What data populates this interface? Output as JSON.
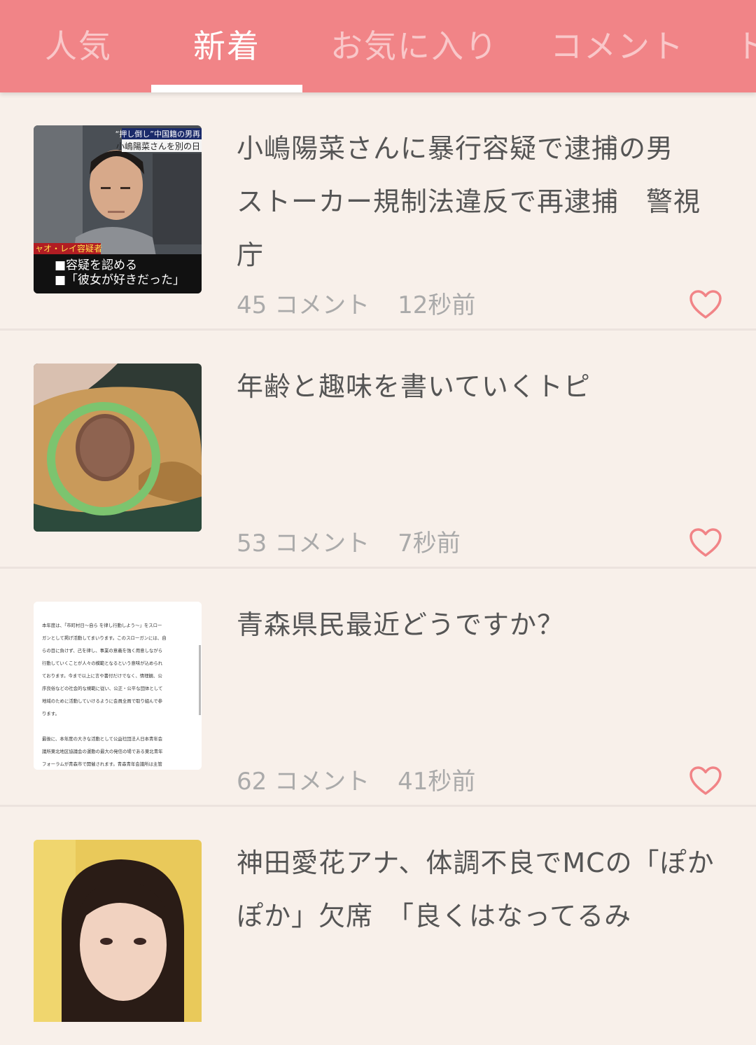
{
  "tabs": [
    {
      "label": "人気",
      "active": false
    },
    {
      "label": "新着",
      "active": true
    },
    {
      "label": "お気に入り",
      "active": false
    },
    {
      "label": "コメント",
      "active": false
    },
    {
      "label": "ト",
      "active": false
    }
  ],
  "colors": {
    "header_bg": "#f18487",
    "page_bg": "#f8f0ea",
    "heart": "#f18487",
    "thumb_ring": "#7cc46f"
  },
  "topics": [
    {
      "title": "小嶋陽菜さんに暴行容疑で逮捕の男　ストーカー規制法違反で再逮捕　警視庁",
      "comments": "45 コメント",
      "time": "12秒前",
      "thumbnail": {
        "caption_top": "“押し倒し”中国籍の男再",
        "caption_sub": "小嶋陽菜さんを別の日",
        "name": "ャオ・レイ容疑者",
        "bullet1": "■容疑を認める",
        "bullet2": "■「彼女が好きだった」"
      }
    },
    {
      "title": "年齢と趣味を書いていくトピ",
      "comments": "53 コメント",
      "time": "7秒前"
    },
    {
      "title": "青森県民最近どうですか？",
      "comments": "62 コメント",
      "time": "41秒前",
      "thumbnail": {
        "lines": [
          "本年度は、「市町村日〜自ら を律し行動しよう〜」をスロー",
          "ガンとして掲げ活動してまいります。このスローガンには、自",
          "らの目に負けず、己を律し、事業の意義を強く用意しながら",
          "行動していくことが人々の模範となるという意味が込められ",
          "ております。今まで以上に言や書付だけでなく、情理観、公",
          "序良俗などの社会的な規範に従い、公正・公平な団体として",
          "地域のために活動していけるように会員全員で取り組んで参",
          "ります。",
          "",
          "最後に、本年度の大きな活動として公益社団法人日本青年会",
          "議所東北地区協議会の運動の最大の発信の場である東北青年",
          "フォーラムが青森市で開催されます。青森青年会議所は主管"
        ]
      }
    },
    {
      "title": "神田愛花アナ、体調不良でMCの「ぽかぽか」欠席　「良くはなってるみ",
      "comments": "",
      "time": ""
    }
  ]
}
